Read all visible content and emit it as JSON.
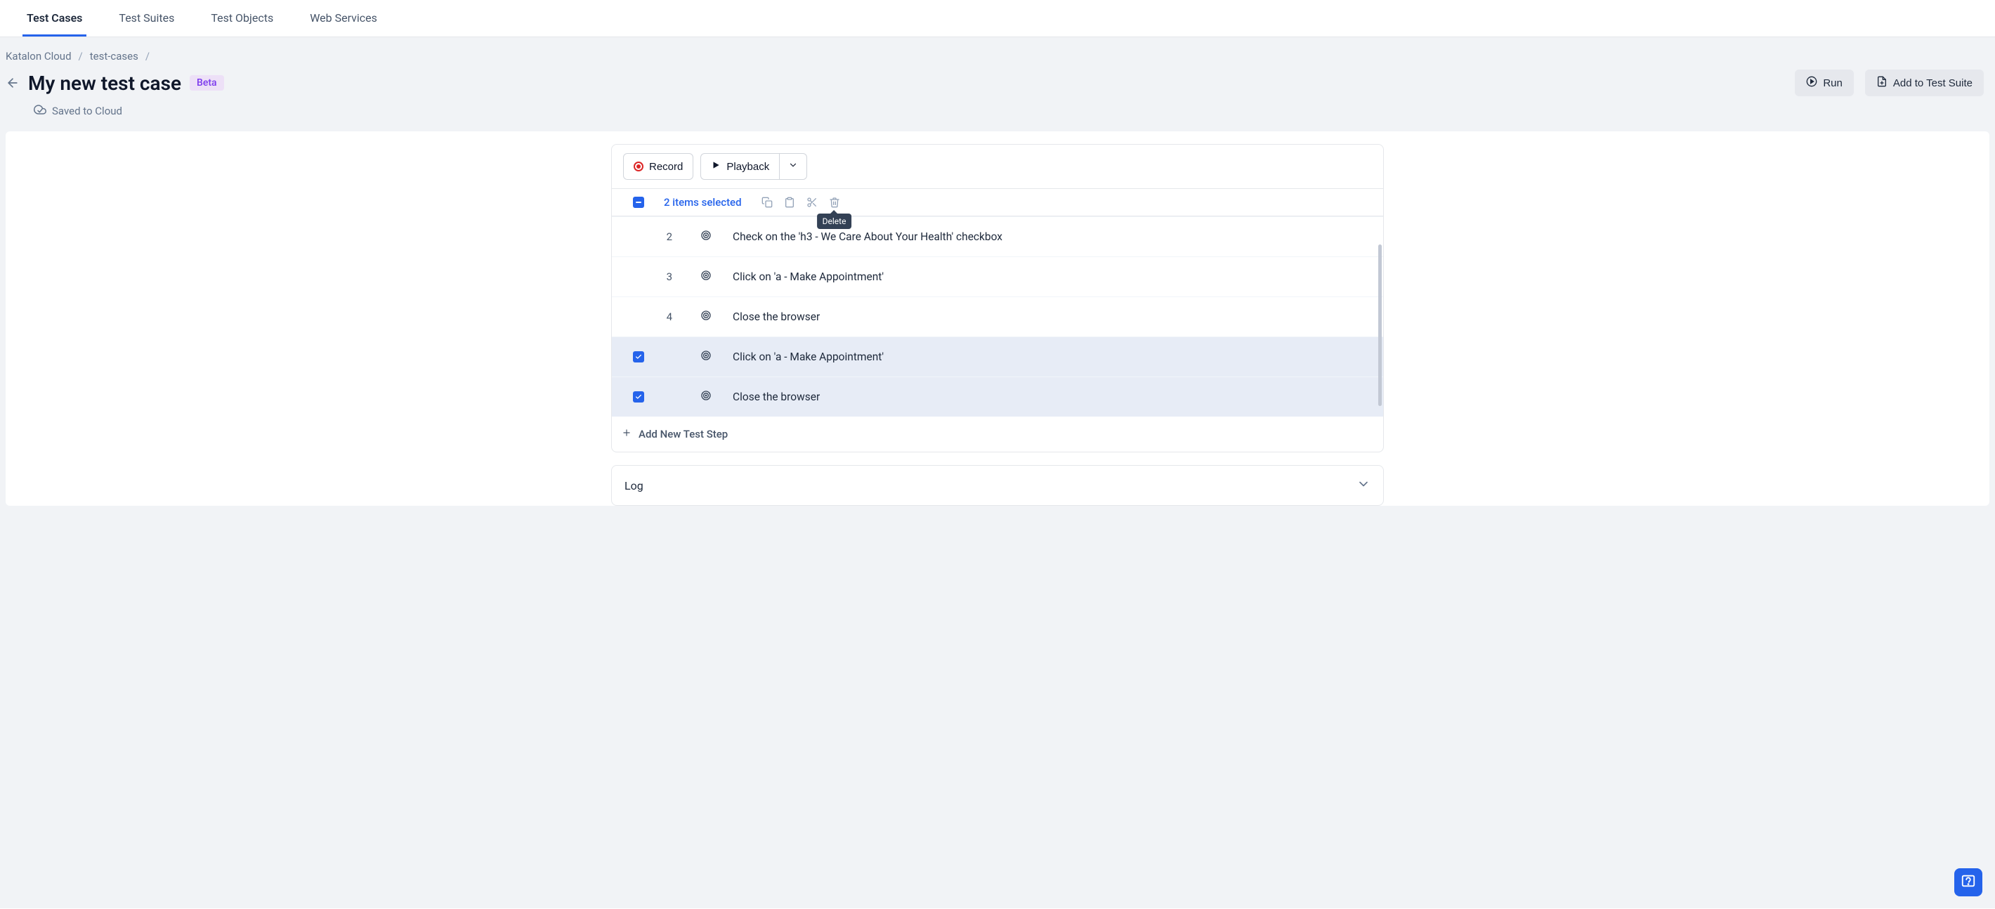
{
  "tabs": {
    "test_cases": "Test Cases",
    "test_suites": "Test Suites",
    "test_objects": "Test Objects",
    "web_services": "Web Services"
  },
  "breadcrumb": {
    "a": "Katalon Cloud",
    "b": "test-cases",
    "sep": "/"
  },
  "header": {
    "title": "My new test case",
    "badge": "Beta",
    "run": "Run",
    "add_to_suite": "Add to Test Suite",
    "saved": "Saved to Cloud"
  },
  "toolbar": {
    "record": "Record",
    "playback": "Playback"
  },
  "selection": {
    "text": "2 items selected",
    "tooltip_delete": "Delete"
  },
  "steps": [
    {
      "num": "2",
      "desc": "Check on the 'h3 - We Care About Your Health' checkbox",
      "selected": false
    },
    {
      "num": "3",
      "desc": "Click on 'a - Make Appointment'",
      "selected": false
    },
    {
      "num": "4",
      "desc": "Close the browser",
      "selected": false
    },
    {
      "num": "",
      "desc": "Click on 'a - Make Appointment'",
      "selected": true
    },
    {
      "num": "",
      "desc": "Close the browser",
      "selected": true
    }
  ],
  "add_step": "Add New Test Step",
  "log": {
    "title": "Log"
  }
}
